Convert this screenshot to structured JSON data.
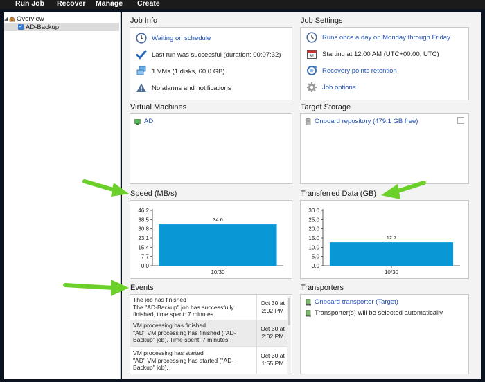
{
  "menu": [
    "Run Job",
    "Recover",
    "Manage",
    "Create"
  ],
  "tree": {
    "root": "Overview",
    "child": "AD-Backup"
  },
  "job_info": {
    "title": "Job Info",
    "status": "Waiting on schedule",
    "last_run": "Last run was successful (duration: 00:07:32)",
    "vms": "1 VMs (1 disks, 60.0 GB)",
    "alarms": "No alarms and notifications"
  },
  "job_settings": {
    "title": "Job Settings",
    "schedule": "Runs once a day on Monday through Friday",
    "start": "Starting at 12:00 AM (UTC+00:00, UTC)",
    "retention": "Recovery points retention",
    "options": "Job options"
  },
  "vms": {
    "title": "Virtual Machines",
    "items": [
      "AD"
    ]
  },
  "target": {
    "title": "Target Storage",
    "repo": "Onboard repository (479.1 GB free)"
  },
  "speed": {
    "title": "Speed (MB/s)"
  },
  "transferred": {
    "title": "Transferred Data (GB)"
  },
  "chart_data": [
    {
      "type": "bar",
      "title": "Speed (MB/s)",
      "categories": [
        "10/30"
      ],
      "values": [
        34.6
      ],
      "value_labels": [
        "34.6"
      ],
      "yticks": [
        "0.0",
        "7.7",
        "15.4",
        "23.1",
        "30.8",
        "38.5",
        "46.2"
      ],
      "ylim": [
        0,
        46.2
      ],
      "color": "#0a97d6"
    },
    {
      "type": "bar",
      "title": "Transferred Data (GB)",
      "categories": [
        "10/30"
      ],
      "values": [
        12.7
      ],
      "value_labels": [
        "12.7"
      ],
      "yticks": [
        "0.0",
        "5.0",
        "10.0",
        "15.0",
        "20.0",
        "25.0",
        "30.0"
      ],
      "ylim": [
        0,
        30
      ],
      "color": "#0a97d6"
    }
  ],
  "events": {
    "title": "Events",
    "rows": [
      {
        "msg": "The job has finished\nThe \"AD-Backup\" job has successfully\nfinished, time spent: 7 minutes.",
        "time": "Oct 30 at\n2:02 PM"
      },
      {
        "msg": "VM processing has finished\n\"AD\" VM processing has finished (\"AD-\nBackup\" job). Time spent: 7 minutes.",
        "time": "Oct 30 at\n2:02 PM"
      },
      {
        "msg": "VM processing has started\n\"AD\" VM processing has started (\"AD-\nBackup\" job).",
        "time": "Oct 30 at\n1:55 PM"
      }
    ]
  },
  "transporters": {
    "title": "Transporters",
    "item1": "Onboard transporter (Target)",
    "item2": "Transporter(s) will be selected automatically"
  },
  "colors": {
    "accent": "#1f4fb5",
    "bar": "#0a97d6",
    "arrow": "#6bd12a"
  }
}
